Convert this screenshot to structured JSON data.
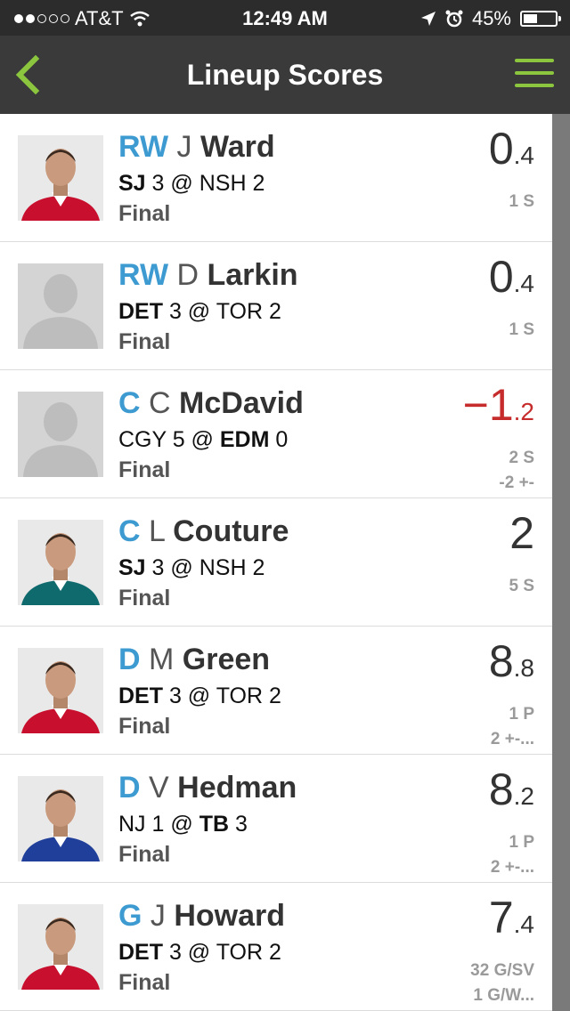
{
  "status_bar": {
    "carrier": "AT&T",
    "time": "12:49 AM",
    "battery": "45%",
    "battery_level": 0.45,
    "signal_bars": 2
  },
  "nav": {
    "title": "Lineup Scores",
    "accent_color": "#8cc63f"
  },
  "colors": {
    "position": "#3d9bd1",
    "negative": "#c62c2c"
  },
  "players": [
    {
      "pos": "RW",
      "initial": "J",
      "last": "Ward",
      "team1": "SJ",
      "score1": "3",
      "team2": "NSH",
      "score2": "2",
      "bold": "team1",
      "status": "Final",
      "pts_int": "0",
      "pts_dec": ".4",
      "negative": false,
      "stat1": "1 S",
      "stat2": "",
      "photo": "photo-jersey-red"
    },
    {
      "pos": "RW",
      "initial": "D",
      "last": "Larkin",
      "team1": "DET",
      "score1": "3",
      "team2": "TOR",
      "score2": "2",
      "bold": "team1",
      "status": "Final",
      "pts_int": "0",
      "pts_dec": ".4",
      "negative": false,
      "stat1": "1 S",
      "stat2": "",
      "photo": "placeholder"
    },
    {
      "pos": "C",
      "initial": "C",
      "last": "McDavid",
      "team1": "CGY",
      "score1": "5",
      "team2": "EDM",
      "score2": "0",
      "bold": "team2",
      "status": "Final",
      "pts_int": "−1",
      "pts_dec": ".2",
      "negative": true,
      "stat1": "2 S",
      "stat2": "-2 +-",
      "photo": "placeholder"
    },
    {
      "pos": "C",
      "initial": "L",
      "last": "Couture",
      "team1": "SJ",
      "score1": "3",
      "team2": "NSH",
      "score2": "2",
      "bold": "team1",
      "status": "Final",
      "pts_int": "2",
      "pts_dec": "",
      "negative": false,
      "stat1": "5 S",
      "stat2": "",
      "photo": "photo-jersey-teal"
    },
    {
      "pos": "D",
      "initial": "M",
      "last": "Green",
      "team1": "DET",
      "score1": "3",
      "team2": "TOR",
      "score2": "2",
      "bold": "team1",
      "status": "Final",
      "pts_int": "8",
      "pts_dec": ".8",
      "negative": false,
      "stat1": "1 P",
      "stat2": "2 +-...",
      "photo": "photo-jersey-red"
    },
    {
      "pos": "D",
      "initial": "V",
      "last": "Hedman",
      "team1": "NJ",
      "score1": "1",
      "team2": "TB",
      "score2": "3",
      "bold": "team2",
      "status": "Final",
      "pts_int": "8",
      "pts_dec": ".2",
      "negative": false,
      "stat1": "1 P",
      "stat2": "2 +-...",
      "photo": "photo-jersey-blue"
    },
    {
      "pos": "G",
      "initial": "J",
      "last": "Howard",
      "team1": "DET",
      "score1": "3",
      "team2": "TOR",
      "score2": "2",
      "bold": "team1",
      "status": "Final",
      "pts_int": "7",
      "pts_dec": ".4",
      "negative": false,
      "stat1": "32 G/SV",
      "stat2": "1 G/W...",
      "photo": "photo-jersey-red"
    }
  ]
}
